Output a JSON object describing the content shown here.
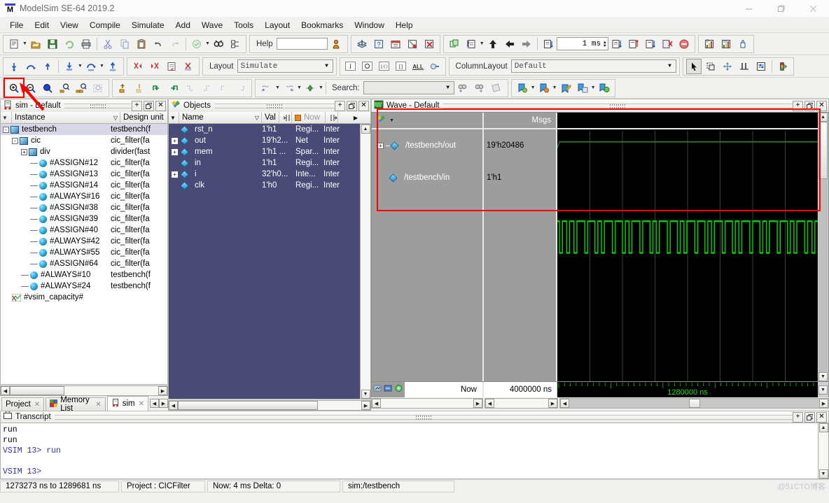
{
  "window": {
    "title": "ModelSim SE-64 2019.2",
    "logo_letter": "M",
    "minimize": "–",
    "maximize": "❐",
    "close": "✕"
  },
  "menu": [
    "File",
    "Edit",
    "View",
    "Compile",
    "Simulate",
    "Add",
    "Wave",
    "Tools",
    "Layout",
    "Bookmarks",
    "Window",
    "Help"
  ],
  "toolbar": {
    "help_label": "Help",
    "help_value": "",
    "layout_label": "Layout",
    "layout_value": "Simulate",
    "column_layout_label": "ColumnLayout",
    "column_layout_value": "Default",
    "run_length_value": "1 ms",
    "search_label": "Search:",
    "search_value": "",
    "icons_row1": [
      "new-file-icon",
      "open-folder-icon",
      "save-icon",
      "reload-icon",
      "print-icon",
      "cut-icon",
      "copy-icon",
      "paste-icon",
      "undo-icon",
      "redo-icon",
      "compile-icon",
      "find-icon",
      "properties-icon"
    ],
    "icons_row2": [
      "step-into-icon",
      "step-over-icon",
      "step-out-icon",
      "run-icon",
      "continue-icon",
      "run-all-icon",
      "break-left-icon",
      "break-right-icon",
      "source-icon",
      "clear-icon"
    ],
    "icons_row3": [
      "zoom-in-icon",
      "zoom-out-icon",
      "zoom-full-icon",
      "zoom-last-icon",
      "zoom-range-icon",
      "zoom-select-icon",
      "cursor-add-icon",
      "cursor-delete-icon",
      "find-prev-transition-icon",
      "find-next-transition-icon"
    ],
    "highlight_icon": "zoom-in-icon"
  },
  "sim_panel": {
    "title": "sim - Default",
    "columns": [
      "Instance",
      "Design unit"
    ],
    "rows": [
      {
        "indent": 0,
        "expander": "-",
        "icon": "module-icon",
        "name": "testbench",
        "unit": "testbench(f",
        "selected": true
      },
      {
        "indent": 1,
        "expander": "-",
        "icon": "module-icon",
        "name": "cic",
        "unit": "cic_filter(fa",
        "selected": false
      },
      {
        "indent": 2,
        "expander": "+",
        "icon": "module-icon",
        "name": "div",
        "unit": "divider(fast",
        "selected": false
      },
      {
        "indent": 3,
        "expander": "",
        "icon": "process-icon",
        "name": "#ASSIGN#12",
        "unit": "cic_filter(fa",
        "selected": false
      },
      {
        "indent": 3,
        "expander": "",
        "icon": "process-icon",
        "name": "#ASSIGN#13",
        "unit": "cic_filter(fa",
        "selected": false
      },
      {
        "indent": 3,
        "expander": "",
        "icon": "process-icon",
        "name": "#ASSIGN#14",
        "unit": "cic_filter(fa",
        "selected": false
      },
      {
        "indent": 3,
        "expander": "",
        "icon": "process-icon",
        "name": "#ALWAYS#16",
        "unit": "cic_filter(fa",
        "selected": false
      },
      {
        "indent": 3,
        "expander": "",
        "icon": "process-icon",
        "name": "#ASSIGN#38",
        "unit": "cic_filter(fa",
        "selected": false
      },
      {
        "indent": 3,
        "expander": "",
        "icon": "process-icon",
        "name": "#ASSIGN#39",
        "unit": "cic_filter(fa",
        "selected": false
      },
      {
        "indent": 3,
        "expander": "",
        "icon": "process-icon",
        "name": "#ASSIGN#40",
        "unit": "cic_filter(fa",
        "selected": false
      },
      {
        "indent": 3,
        "expander": "",
        "icon": "process-icon",
        "name": "#ALWAYS#42",
        "unit": "cic_filter(fa",
        "selected": false
      },
      {
        "indent": 3,
        "expander": "",
        "icon": "process-icon",
        "name": "#ALWAYS#55",
        "unit": "cic_filter(fa",
        "selected": false
      },
      {
        "indent": 3,
        "expander": "",
        "icon": "process-icon",
        "name": "#ASSIGN#64",
        "unit": "cic_filter(fa",
        "selected": false
      },
      {
        "indent": 2,
        "expander": "",
        "icon": "process-icon",
        "name": "#ALWAYS#10",
        "unit": "testbench(f",
        "selected": false
      },
      {
        "indent": 2,
        "expander": "",
        "icon": "process-icon",
        "name": "#ALWAYS#24",
        "unit": "testbench(f",
        "selected": false
      },
      {
        "indent": 1,
        "expander": "",
        "icon": "capacity-icon",
        "name": "#vsim_capacity#",
        "unit": "",
        "selected": false
      }
    ]
  },
  "objects_panel": {
    "title": "Objects",
    "columns": [
      "Name",
      "Val",
      "Now"
    ],
    "rows": [
      {
        "expander": "",
        "name": "rst_n",
        "value": "1'h1",
        "kind": "Regi...",
        "scope": "Inter"
      },
      {
        "expander": "+",
        "name": "out",
        "value": "19'h2...",
        "kind": "Net",
        "scope": "Inter"
      },
      {
        "expander": "+",
        "name": "mem",
        "value": "1'h1 ...",
        "kind": "Spar...",
        "scope": "Inter"
      },
      {
        "expander": "",
        "name": "in",
        "value": "1'h1",
        "kind": "Regi...",
        "scope": "Inter"
      },
      {
        "expander": "+",
        "name": "i",
        "value": "32'h0...",
        "kind": "Inte...",
        "scope": "Inter"
      },
      {
        "expander": "",
        "name": "clk",
        "value": "1'h0",
        "kind": "Regi...",
        "scope": "Inter"
      }
    ]
  },
  "wave_panel": {
    "title": "Wave - Default",
    "msgs_header": "Msgs",
    "signals": [
      {
        "name": "/testbench/out",
        "value": "19'h20486",
        "expander": "+",
        "type": "bus"
      },
      {
        "name": "/testbench/in",
        "value": "1'h1",
        "expander": "",
        "type": "clock"
      }
    ],
    "now_label": "Now",
    "now_value": "4000000 ns",
    "cursor_time": "1280000 ns"
  },
  "bottom_tabs": [
    {
      "label": "Project",
      "active": false,
      "icon": ""
    },
    {
      "label": "Memory List",
      "active": false,
      "icon": "memory-icon"
    },
    {
      "label": "sim",
      "active": true,
      "icon": "sim-icon"
    }
  ],
  "transcript": {
    "title": "Transcript",
    "lines": [
      {
        "text": "run",
        "prompt": false
      },
      {
        "text": "run",
        "prompt": false
      },
      {
        "text": "VSIM 13> run",
        "prompt": true
      },
      {
        "text": "",
        "prompt": false
      },
      {
        "text": "VSIM 13>",
        "prompt": true
      }
    ]
  },
  "statusbar": {
    "range": "1273273 ns to 1289681 ns",
    "project": "Project : CICFilter",
    "now": "Now: 4 ms  Delta: 0",
    "context": "sim:/testbench",
    "watermark": "@51CTO博客"
  },
  "colors": {
    "wave_green": "#00d000",
    "highlight_red": "#ff0000",
    "objects_bg": "#4a4a77",
    "selection_blue": "#d7d7e8"
  }
}
